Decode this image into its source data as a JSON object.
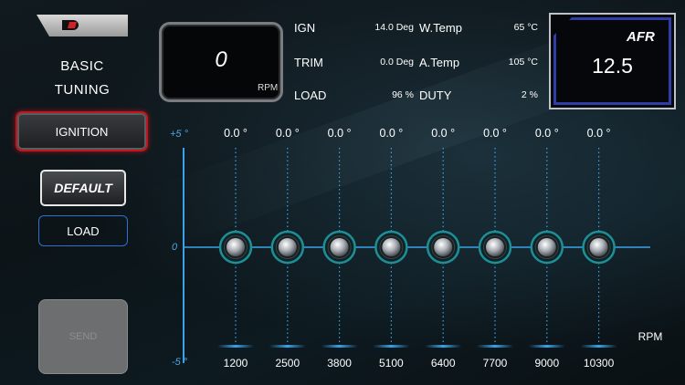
{
  "left": {
    "title_line1": "BASIC",
    "title_line2": "TUNING",
    "ignition_label": "IGNITION",
    "default_label": "DEFAULT",
    "load_label": "LOAD",
    "send_label": "SEND"
  },
  "gauge": {
    "rpm_value": "0",
    "rpm_unit": "RPM"
  },
  "info": {
    "ign_label": "IGN",
    "ign_value": "14.0 Deg",
    "trim_label": "TRIM",
    "trim_value": "0.0 Deg",
    "load_label": "LOAD",
    "load_value": "96 %",
    "wtemp_label": "W.Temp",
    "wtemp_value": "65 °C",
    "atemp_label": "A.Temp",
    "atemp_value": "105 °C",
    "duty_label": "DUTY",
    "duty_value": "2 %"
  },
  "afr": {
    "label": "AFR",
    "value": "12.5"
  },
  "tuning": {
    "axis_top": "+5 °",
    "axis_mid": "0",
    "axis_bottom": "-5 °",
    "rpm_axis_label": "RPM",
    "points": [
      {
        "rpm": "1200",
        "offset_label": "0.0 °",
        "offset": 0.0
      },
      {
        "rpm": "2500",
        "offset_label": "0.0 °",
        "offset": 0.0
      },
      {
        "rpm": "3800",
        "offset_label": "0.0 °",
        "offset": 0.0
      },
      {
        "rpm": "5100",
        "offset_label": "0.0 °",
        "offset": 0.0
      },
      {
        "rpm": "6400",
        "offset_label": "0.0 °",
        "offset": 0.0
      },
      {
        "rpm": "7700",
        "offset_label": "0.0 °",
        "offset": 0.0
      },
      {
        "rpm": "9000",
        "offset_label": "0.0 °",
        "offset": 0.0
      },
      {
        "rpm": "10300",
        "offset_label": "0.0 °",
        "offset": 0.0
      }
    ]
  },
  "colors": {
    "accent_blue": "#3aa3e8",
    "active_red": "#c0161f",
    "afr_border": "#2f3ea6"
  }
}
